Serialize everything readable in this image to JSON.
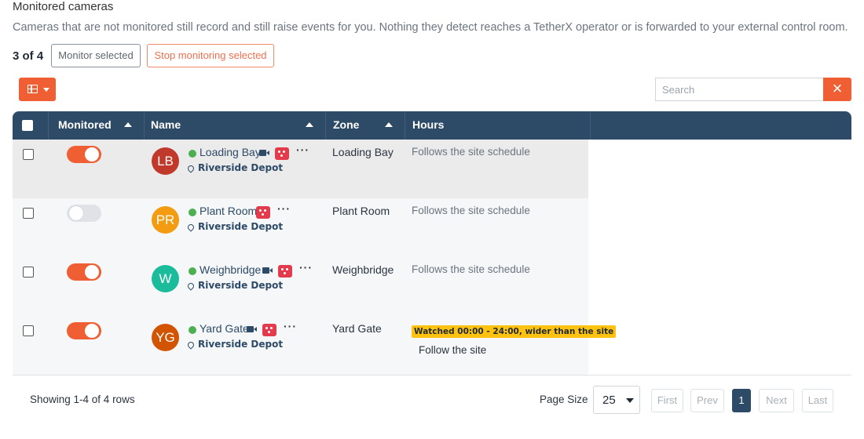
{
  "header": {
    "title": "Monitored cameras",
    "description": "Cameras that are not monitored still record and still raise events for you. Nothing they detect reaches a TetherX operator or is forwarded to your external control room."
  },
  "selection": {
    "count": "3 of 4",
    "monitor_label": "Monitor selected",
    "stop_label": "Stop monitoring selected"
  },
  "toolbar": {
    "columns_icon": "table-columns-icon",
    "search_placeholder": "Search",
    "clear_icon": "close-icon",
    "clear_glyph": "×"
  },
  "table": {
    "columns": [
      "Monitored",
      "Name",
      "Zone",
      "Hours"
    ],
    "rows": [
      {
        "monitored": true,
        "initials": "LB",
        "avatar_color": "#c0392b",
        "name": "Loading Bay",
        "site": "Riverside Depot",
        "zone": "Loading Bay",
        "hours": "Follows the site schedule",
        "has_video": true,
        "selected_bg": true
      },
      {
        "monitored": false,
        "initials": "PR",
        "avatar_color": "#f39c12",
        "name": "Plant Room",
        "site": "Riverside Depot",
        "zone": "Plant Room",
        "hours": "Follows the site schedule",
        "has_video": false
      },
      {
        "monitored": true,
        "initials": "W",
        "avatar_color": "#1abc9c",
        "name": "Weighbridge",
        "site": "Riverside Depot",
        "zone": "Weighbridge",
        "hours": "Follows the site schedule",
        "has_video": true
      },
      {
        "monitored": true,
        "initials": "YG",
        "avatar_color": "#d35400",
        "name": "Yard Gate",
        "site": "Riverside Depot",
        "zone": "Yard Gate",
        "hours_warning": "Watched 00:00 - 24:00, wider than the site",
        "hours_follow": "Follow the site",
        "has_video": true
      }
    ],
    "more_glyph": "···"
  },
  "footer": {
    "showing": "Showing 1-4 of 4 rows",
    "page_size_label": "Page Size",
    "page_size": "25",
    "pager": {
      "first": "First",
      "prev": "Prev",
      "current": "1",
      "next": "Next",
      "last": "Last"
    }
  },
  "colors": {
    "accent": "#ef5f33",
    "header_bg": "#2d4a67",
    "status_online": "#4caf50",
    "warning": "#ffc20e"
  }
}
